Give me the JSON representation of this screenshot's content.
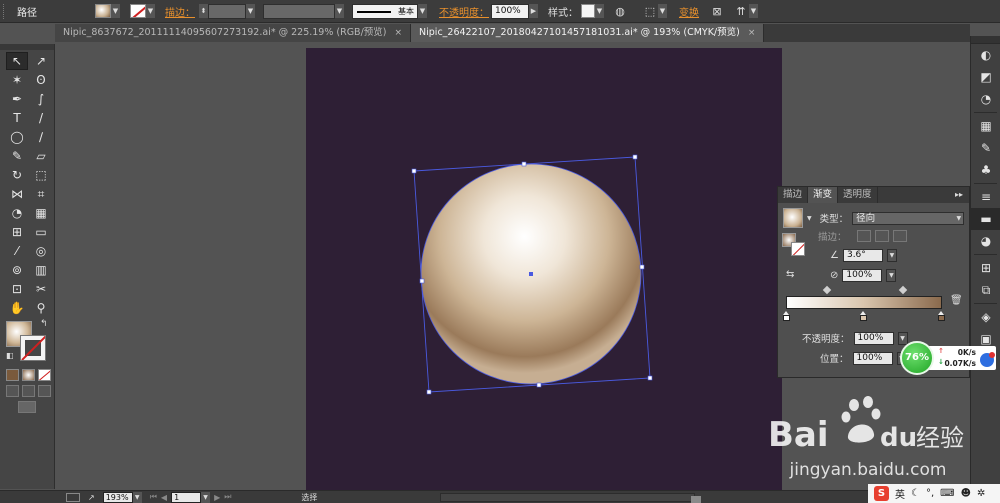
{
  "control_bar": {
    "object_type": "路径",
    "stroke_label": "描边：",
    "stroke_style_label": "基本",
    "opacity_label": "不透明度：",
    "opacity_value": "100%",
    "style_label": "样式：",
    "transform_label": "变换"
  },
  "tabs": [
    {
      "title": "Nipic_8637672_20111114095607273192.ai* @ 225.19% (RGB/预览)",
      "close": "×",
      "active": false
    },
    {
      "title": "Nipic_26422107_20180427101457181031.ai* @ 193% (CMYK/预览)",
      "close": "×",
      "active": true
    }
  ],
  "tools": [
    {
      "name": "selection-tool",
      "icon": "↖"
    },
    {
      "name": "direct-selection-tool",
      "icon": "↗"
    },
    {
      "name": "magic-wand-tool",
      "icon": "✶"
    },
    {
      "name": "lasso-tool",
      "icon": "ʘ"
    },
    {
      "name": "pen-tool",
      "icon": "✒"
    },
    {
      "name": "curvature-tool",
      "icon": "∫"
    },
    {
      "name": "type-tool",
      "icon": "T"
    },
    {
      "name": "line-segment-tool",
      "icon": "/"
    },
    {
      "name": "ellipse-tool",
      "icon": "◯"
    },
    {
      "name": "paintbrush-tool",
      "icon": "∕"
    },
    {
      "name": "pencil-tool",
      "icon": "✎"
    },
    {
      "name": "eraser-tool",
      "icon": "▱"
    },
    {
      "name": "rotate-tool",
      "icon": "↻"
    },
    {
      "name": "scale-tool",
      "icon": "⬚"
    },
    {
      "name": "width-tool",
      "icon": "⋈"
    },
    {
      "name": "free-transform-tool",
      "icon": "⌗"
    },
    {
      "name": "shape-builder-tool",
      "icon": "◔"
    },
    {
      "name": "perspective-grid-tool",
      "icon": "▦"
    },
    {
      "name": "mesh-tool",
      "icon": "⊞"
    },
    {
      "name": "gradient-tool",
      "icon": "▭"
    },
    {
      "name": "eyedropper-tool",
      "icon": "⁄"
    },
    {
      "name": "blend-tool",
      "icon": "◎"
    },
    {
      "name": "symbol-sprayer-tool",
      "icon": "⊚"
    },
    {
      "name": "column-graph-tool",
      "icon": "▥"
    },
    {
      "name": "artboard-tool",
      "icon": "⊡"
    },
    {
      "name": "slice-tool",
      "icon": "✂"
    },
    {
      "name": "hand-tool",
      "icon": "✋"
    },
    {
      "name": "zoom-tool",
      "icon": "⚲"
    }
  ],
  "gradient_panel": {
    "tab_stroke": "描边",
    "tab_gradient": "渐变",
    "tab_transparency": "透明度",
    "menu_icon": "▸▸",
    "type_label": "类型：",
    "type_value": "径向",
    "stroke_label": "描边：",
    "angle_value": "3.6°",
    "aspect_value": "100%",
    "opacity_label": "不透明度：",
    "opacity_value": "100%",
    "location_label": "位置：",
    "location_value": "100%"
  },
  "network_widget": {
    "percent": "76%",
    "up_speed": "0K/s",
    "down_speed": "0.07K/s"
  },
  "status_bar": {
    "zoom": "193%",
    "page": "1",
    "tool_name": "选择"
  },
  "watermark": {
    "brand_latin": "Bai",
    "brand_latin_end": "du",
    "brand_cn": "经验",
    "url": "jingyan.baidu.com"
  },
  "tray": {
    "logo": "S",
    "ime": "英"
  },
  "colors": {
    "artboard": "#2e1f35",
    "sphere_highlight": "#ffffff",
    "sphere_mid": "#d9c5ad",
    "sphere_edge": "#8a6a4d",
    "selection": "#4a5ae0"
  }
}
